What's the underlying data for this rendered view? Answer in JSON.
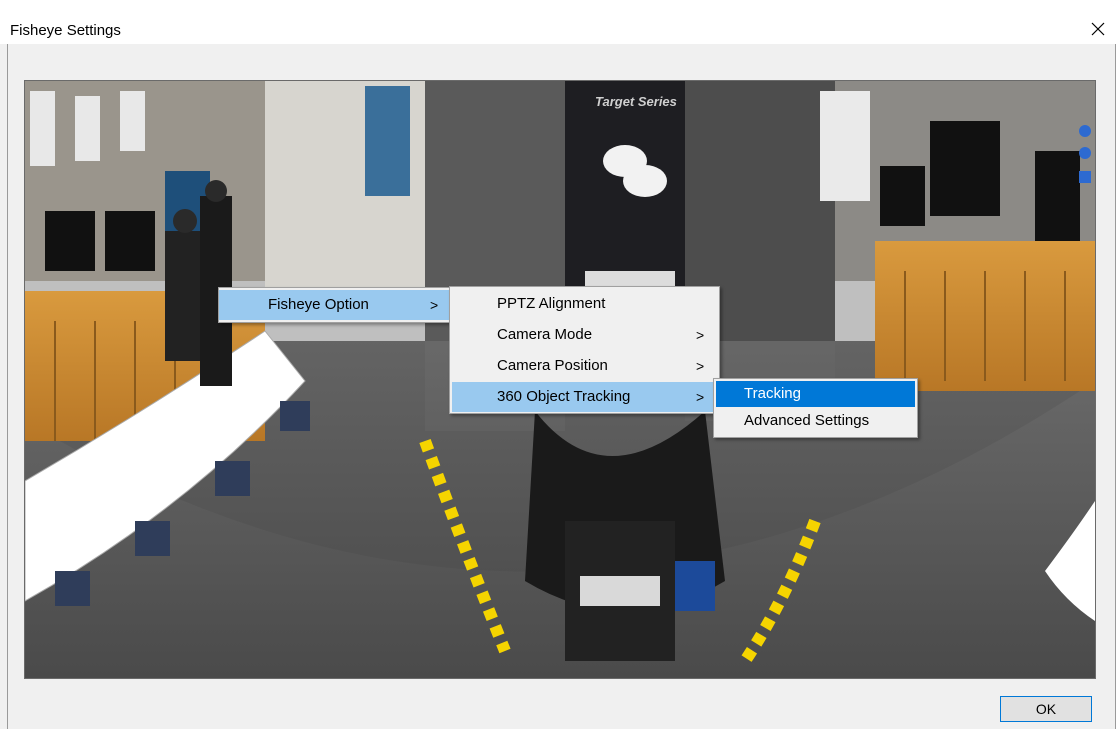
{
  "window": {
    "title": "Fisheye Settings",
    "close_glyph": "✕"
  },
  "viewer": {
    "poster_text": "Target Series"
  },
  "context_menu": {
    "root": {
      "label": "Fisheye Option",
      "arrow": ">"
    },
    "submenu": [
      {
        "label": "PPTZ Alignment",
        "arrow": ""
      },
      {
        "label": "Camera Mode",
        "arrow": ">"
      },
      {
        "label": "Camera Position",
        "arrow": ">"
      },
      {
        "label": "360 Object Tracking",
        "arrow": ">"
      }
    ],
    "tracking_submenu": [
      {
        "label": "Tracking",
        "selected": true
      },
      {
        "label": "Advanced Settings",
        "selected": false
      }
    ]
  },
  "footer": {
    "ok_label": "OK"
  },
  "colors": {
    "highlight": "#99c9ef",
    "selected": "#0078d7"
  },
  "icons": [
    "close-icon",
    "chevron-right-icon"
  ]
}
